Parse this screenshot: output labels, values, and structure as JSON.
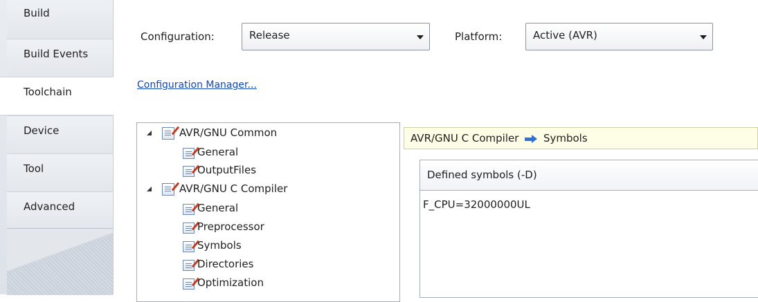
{
  "sidebar": {
    "tabs": [
      {
        "label": "Build"
      },
      {
        "label": "Build Events"
      },
      {
        "label": "Toolchain",
        "active": true
      },
      {
        "label": "Device"
      },
      {
        "label": "Tool"
      },
      {
        "label": "Advanced"
      }
    ]
  },
  "config": {
    "configuration_label": "Configuration:",
    "configuration_value": "Release",
    "platform_label": "Platform:",
    "platform_value": "Active (AVR)",
    "manager_link": "Configuration Manager..."
  },
  "tree": {
    "nodes": [
      {
        "label": "AVR/GNU Common",
        "level": 0,
        "expanded": true
      },
      {
        "label": "General",
        "level": 1
      },
      {
        "label": "OutputFiles",
        "level": 1
      },
      {
        "label": "AVR/GNU C Compiler",
        "level": 0,
        "expanded": true
      },
      {
        "label": "General",
        "level": 1
      },
      {
        "label": "Preprocessor",
        "level": 1
      },
      {
        "label": "Symbols",
        "level": 1
      },
      {
        "label": "Directories",
        "level": 1
      },
      {
        "label": "Optimization",
        "level": 1
      }
    ]
  },
  "panel": {
    "breadcrumb_parent": "AVR/GNU C Compiler",
    "breadcrumb_child": "Symbols",
    "symbols_header": "Defined symbols (-D)",
    "symbols": [
      "F_CPU=32000000UL"
    ]
  },
  "icons": {
    "tree_node": "property-page-icon",
    "breadcrumb_separator": "right-arrow-icon",
    "dropdown": "chevron-down-icon"
  },
  "colors": {
    "link": "#0f47b8",
    "breadcrumb_bg": "#fefde6",
    "arrow": "#2f6fd6"
  }
}
